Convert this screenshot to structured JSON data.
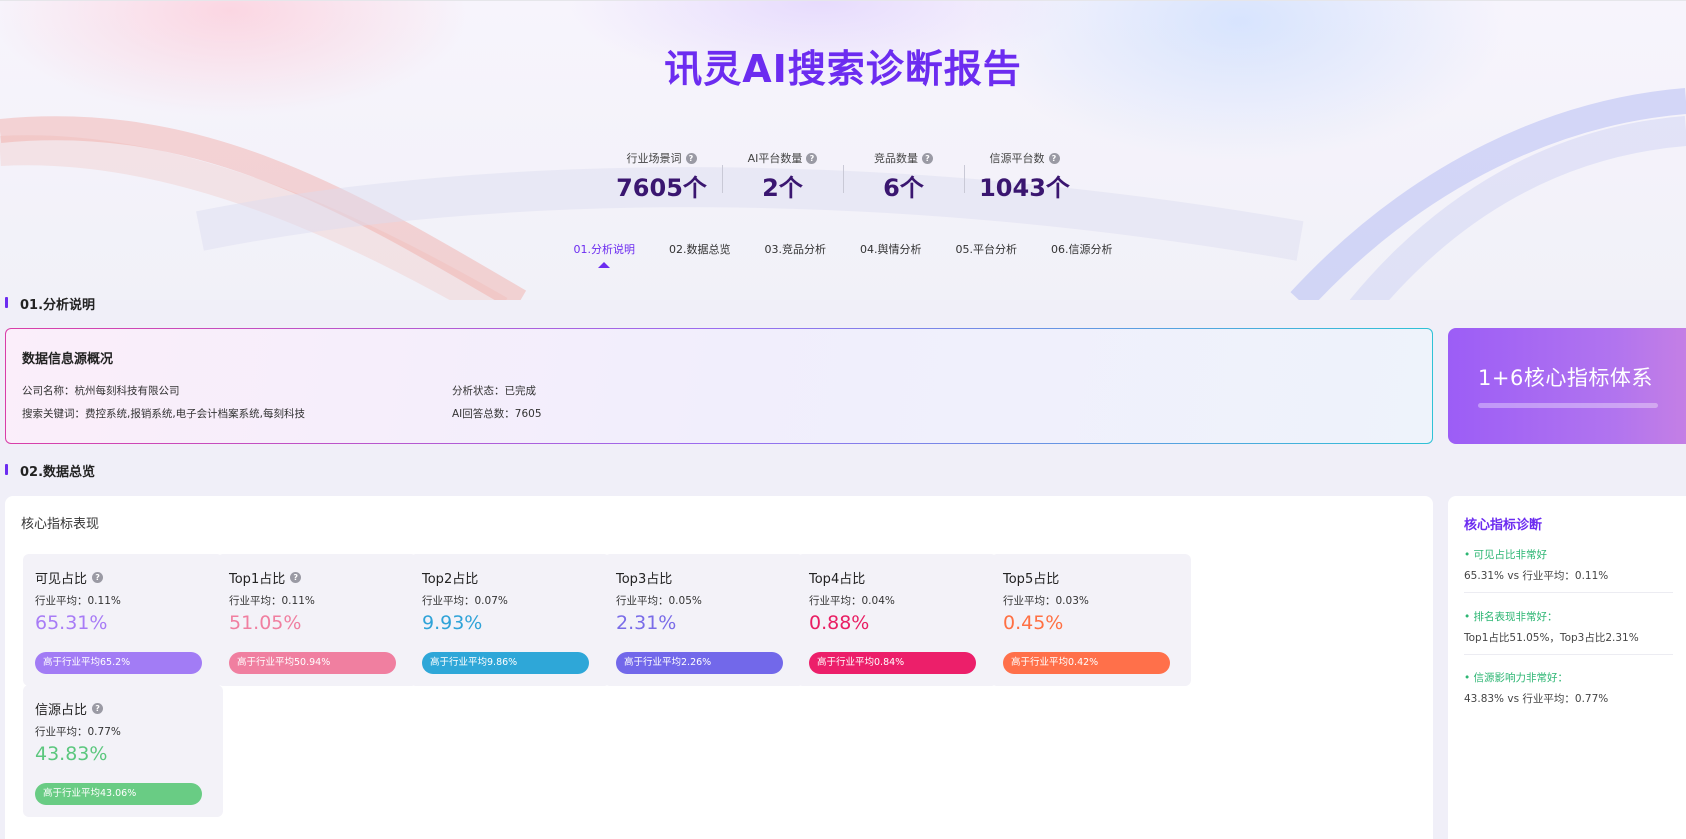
{
  "title": "讯灵AI搜索诊断报告",
  "stats": [
    {
      "label": "行业场景词",
      "value": "7605个"
    },
    {
      "label": "AI平台数量",
      "value": "2个"
    },
    {
      "label": "竞品数量",
      "value": "6个"
    },
    {
      "label": "信源平台数",
      "value": "1043个"
    }
  ],
  "help_icon_glyph": "?",
  "tabs": [
    "01.分析说明",
    "02.数据总览",
    "03.竞品分析",
    "04.舆情分析",
    "05.平台分析",
    "06.信源分析"
  ],
  "active_tab": 0,
  "section1": {
    "heading": "01.分析说明",
    "card_title": "数据信息源概况",
    "company": "公司名称：杭州每刻科技有限公司",
    "keywords": "搜索关键词：费控系统,报销系统,电子会计档案系统,每刻科技",
    "status": "分析状态：已完成",
    "answers": "AI回答总数：7605",
    "banner": "1+6核心指标体系"
  },
  "section2": {
    "heading": "02.数据总览",
    "panel_title": "核心指标表现",
    "metrics": [
      {
        "title": "可见占比",
        "help": true,
        "avg": "行业平均：0.11%",
        "value": "65.31%",
        "pill": "高于行业平均65.2%",
        "color": "#a87cf6",
        "pill_color": "#a27cf5"
      },
      {
        "title": "Top1占比",
        "help": true,
        "avg": "行业平均：0.11%",
        "value": "51.05%",
        "pill": "高于行业平均50.94%",
        "color": "#f07fa0",
        "pill_color": "#f07fa0"
      },
      {
        "title": "Top2占比",
        "help": false,
        "avg": "行业平均：0.07%",
        "value": "9.93%",
        "pill": "高于行业平均9.86%",
        "color": "#2fa3d8",
        "pill_color": "#2ea7d8"
      },
      {
        "title": "Top3占比",
        "help": false,
        "avg": "行业平均：0.05%",
        "value": "2.31%",
        "pill": "高于行业平均2.26%",
        "color": "#7a6ce8",
        "pill_color": "#7268ea"
      },
      {
        "title": "Top4占比",
        "help": false,
        "avg": "行业平均：0.04%",
        "value": "0.88%",
        "pill": "高于行业平均0.84%",
        "color": "#e91e63",
        "pill_color": "#ec1f6a"
      },
      {
        "title": "Top5占比",
        "help": false,
        "avg": "行业平均：0.03%",
        "value": "0.45%",
        "pill": "高于行业平均0.42%",
        "color": "#ff7043",
        "pill_color": "#ff704a"
      },
      {
        "title": "信源占比",
        "help": true,
        "avg": "行业平均：0.77%",
        "value": "43.83%",
        "pill": "高于行业平均43.06%",
        "color": "#5cc77e",
        "pill_color": "#69cc84"
      }
    ]
  },
  "diagnosis": {
    "heading": "核心指标诊断",
    "items": [
      {
        "title": "• 可见占比非常好",
        "detail": "65.31% vs 行业平均：0.11%"
      },
      {
        "title": "• 排名表现非常好：",
        "detail": "Top1占比51.05%，Top3占比2.31%"
      },
      {
        "title": "• 信源影响力非常好：",
        "detail": "43.83% vs 行业平均：0.77%"
      }
    ]
  }
}
